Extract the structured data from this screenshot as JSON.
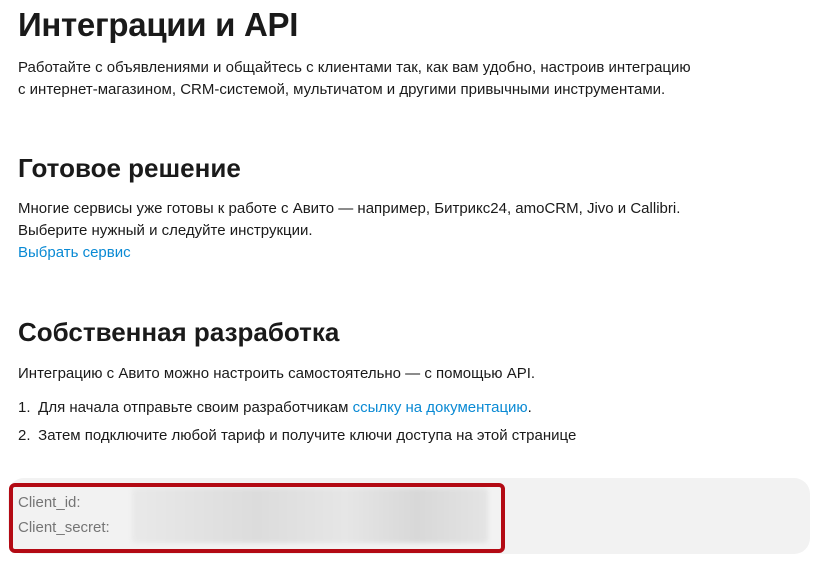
{
  "header": {
    "title": "Интеграции и API",
    "intro_line1": "Работайте с объявлениями и общайтесь с клиентами так, как вам удобно, настроив интеграцию",
    "intro_line2": "с интернет-магазином, CRM-системой, мультичатом и другими привычными инструментами."
  },
  "ready_solution": {
    "title": "Готовое решение",
    "text_line1": "Многие сервисы уже готовы к работе с Авито — например, Битрикс24, amoCRM, Jivo и Callibri.",
    "text_line2": "Выберите нужный и следуйте инструкции.",
    "link_label": "Выбрать сервис"
  },
  "own_development": {
    "title": "Собственная разработка",
    "text": "Интеграцию с Авито можно настроить самостоятельно — с помощью API.",
    "steps": [
      {
        "num": "1.",
        "text_before": "Для начала отправьте своим разработчикам ",
        "link": "ссылку на документацию",
        "text_after": "."
      },
      {
        "num": "2.",
        "text_before": "Затем подключите любой тариф и получите ключи доступа на этой странице",
        "link": "",
        "text_after": ""
      }
    ]
  },
  "keys": {
    "client_id_label": "Client_id:",
    "client_secret_label": "Client_secret:"
  },
  "colors": {
    "link": "#0a8ad4",
    "highlight_border": "#b30a14",
    "panel_bg": "#f2f2f2"
  }
}
